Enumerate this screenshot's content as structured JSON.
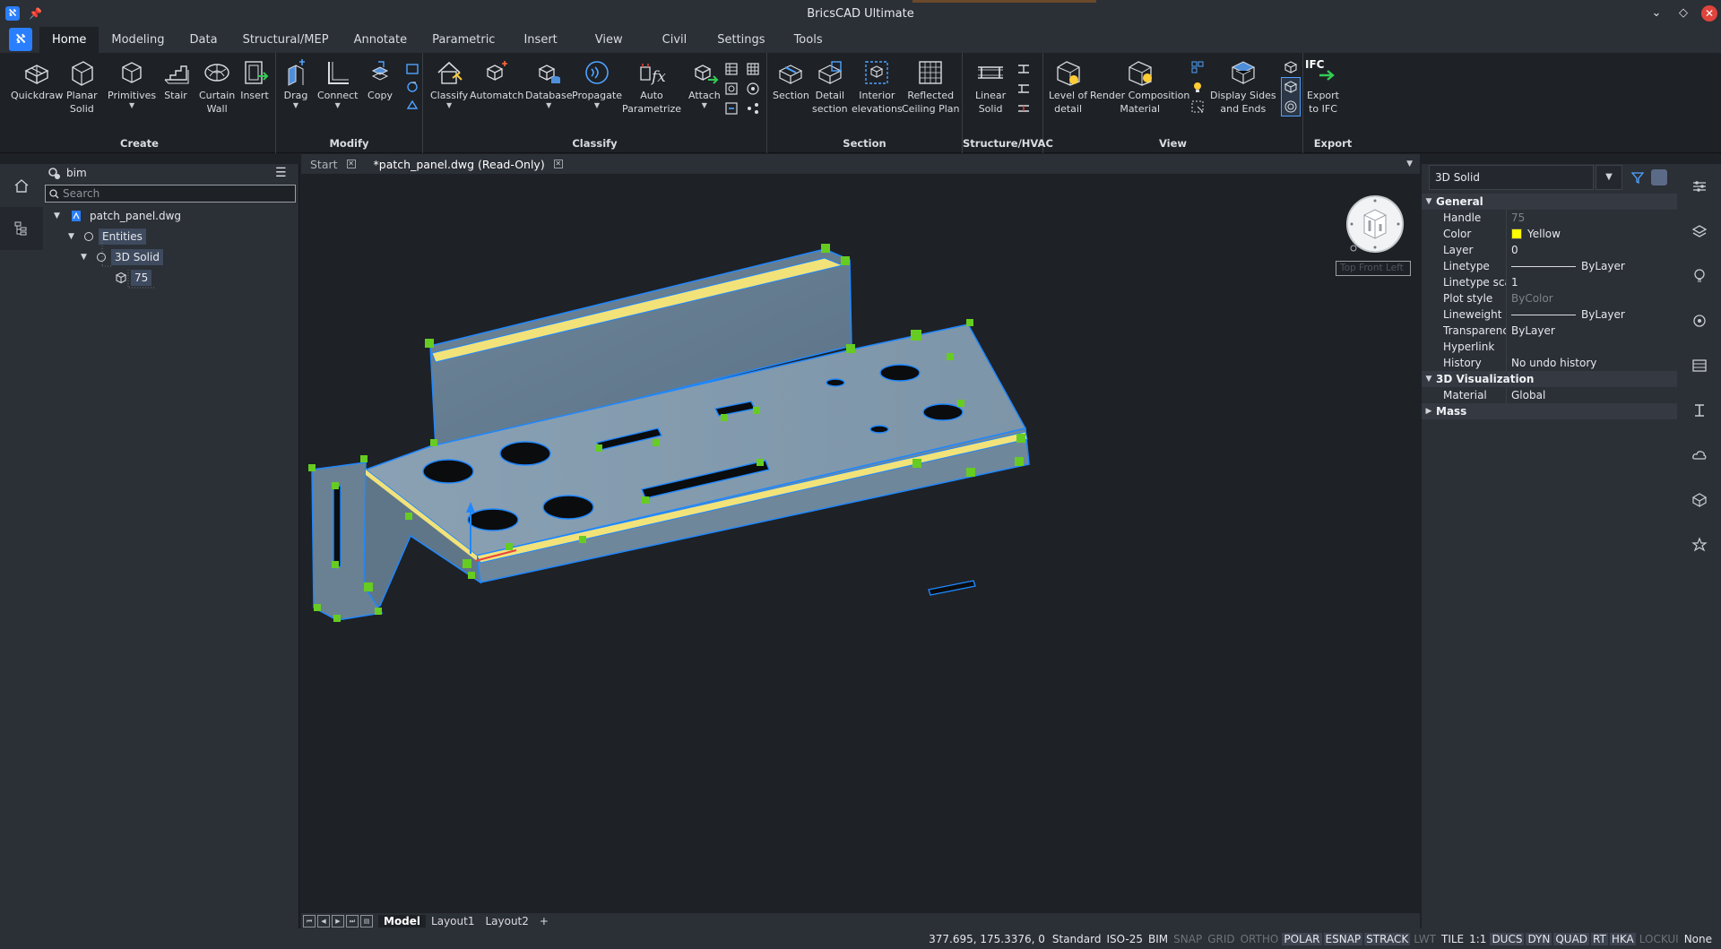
{
  "app": {
    "title": "BricsCAD Ultimate"
  },
  "ribbon": {
    "tabs": [
      "Home",
      "Modeling",
      "Data",
      "Structural/MEP",
      "Annotate",
      "Parametric",
      "Insert",
      "View",
      "Civil",
      "Settings",
      "Tools"
    ],
    "active_tab": "Home",
    "groups": {
      "create": "Create",
      "modify": "Modify",
      "classify": "Classify",
      "section": "Section",
      "structure": "Structure/HVAC",
      "view": "View",
      "export": "Export"
    },
    "buttons": {
      "quickdraw": "Quickdraw",
      "planar_solid_1": "Planar",
      "planar_solid_2": "Solid",
      "primitives": "Primitives",
      "stair": "Stair",
      "curtain_wall_1": "Curtain",
      "curtain_wall_2": "Wall",
      "insert": "Insert",
      "drag": "Drag",
      "connect": "Connect",
      "copy": "Copy",
      "classify": "Classify",
      "automatch": "Automatch",
      "database": "Database",
      "propagate": "Propagate",
      "auto_param_1": "Auto",
      "auto_param_2": "Parametrize",
      "attach": "Attach",
      "section": "Section",
      "detail_section_1": "Detail",
      "detail_section_2": "section",
      "interior_elev_1": "Interior",
      "interior_elev_2": "elevations",
      "reflected_1": "Reflected",
      "reflected_2": "Ceiling Plan",
      "linear_solid_1": "Linear",
      "linear_solid_2": "Solid",
      "level_detail_1": "Level of",
      "level_detail_2": "detail",
      "render_comp_1": "Render Composition",
      "render_comp_2": "Material",
      "display_sides_1": "Display Sides",
      "display_sides_2": "and Ends",
      "ifc_badge": "IFC",
      "export_ifc_1": "Export",
      "export_ifc_2": "to IFC"
    }
  },
  "browser": {
    "title": "bim",
    "search_placeholder": "Search",
    "tree": [
      {
        "label": "patch_panel.dwg"
      },
      {
        "label": "Entities"
      },
      {
        "label": "3D Solid"
      },
      {
        "label": "75"
      }
    ]
  },
  "doc_tabs": [
    {
      "label": "Start"
    },
    {
      "label": "*patch_panel.dwg (Read-Only)"
    }
  ],
  "viewcube": {
    "label": "Top Front Left"
  },
  "layout_tabs": [
    "Model",
    "Layout1",
    "Layout2"
  ],
  "layout_add": "+",
  "properties": {
    "selection": "3D Solid",
    "categories": {
      "general": "General",
      "visualization": "3D Visualization",
      "mass": "Mass"
    },
    "general": [
      {
        "k": "Handle",
        "v": "75"
      },
      {
        "k": "Color",
        "v": "Yellow"
      },
      {
        "k": "Layer",
        "v": "0"
      },
      {
        "k": "Linetype",
        "v": "ByLayer"
      },
      {
        "k": "Linetype scale",
        "v": "1"
      },
      {
        "k": "Plot style",
        "v": "ByColor"
      },
      {
        "k": "Lineweight",
        "v": "ByLayer"
      },
      {
        "k": "Transparency",
        "v": "ByLayer"
      },
      {
        "k": "Hyperlink",
        "v": ""
      },
      {
        "k": "History",
        "v": "No undo history"
      }
    ],
    "visualization": [
      {
        "k": "Material",
        "v": "Global"
      }
    ],
    "color_swatch": "#ffff00"
  },
  "status": {
    "coords": "377.695, 175.3376, 0",
    "items": [
      {
        "label": "Standard",
        "state": "plain"
      },
      {
        "label": "ISO-25",
        "state": "plain"
      },
      {
        "label": "BIM",
        "state": "plain"
      },
      {
        "label": "SNAP",
        "state": "off"
      },
      {
        "label": "GRID",
        "state": "off"
      },
      {
        "label": "ORTHO",
        "state": "off"
      },
      {
        "label": "POLAR",
        "state": "on"
      },
      {
        "label": "ESNAP",
        "state": "on"
      },
      {
        "label": "STRACK",
        "state": "on"
      },
      {
        "label": "LWT",
        "state": "off"
      },
      {
        "label": "TILE",
        "state": "plain"
      },
      {
        "label": "1:1",
        "state": "plain"
      },
      {
        "label": "DUCS",
        "state": "on"
      },
      {
        "label": "DYN",
        "state": "on"
      },
      {
        "label": "QUAD",
        "state": "on"
      },
      {
        "label": "RT",
        "state": "on"
      },
      {
        "label": "HKA",
        "state": "on"
      },
      {
        "label": "LOCKUI",
        "state": "off"
      },
      {
        "label": "None",
        "state": "plain"
      }
    ]
  },
  "colors": {
    "accent": "#2a7fff",
    "selection": "#3e4a5e",
    "grip": "#66cc22",
    "solid_face": "#7f98ad",
    "solid_edge": "#1e88ff",
    "highlight_edge": "#ffee55"
  }
}
